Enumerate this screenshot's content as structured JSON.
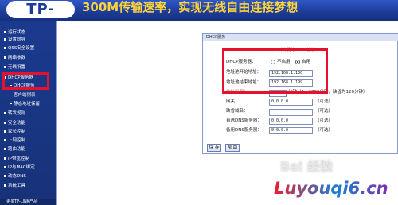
{
  "banner": {
    "logo": "TP-LINK",
    "slogan": "300M传输速率，实现无线自由连接梦想"
  },
  "sidebar": {
    "items": [
      {
        "label": "运行状态",
        "kind": "item"
      },
      {
        "label": "设置向导",
        "kind": "item"
      },
      {
        "label": "QSS安全设置",
        "kind": "item"
      },
      {
        "label": "网络参数",
        "kind": "item"
      },
      {
        "label": "无线设置",
        "kind": "item"
      },
      {
        "label": "DHCP服务器",
        "kind": "item"
      },
      {
        "label": "DHCP服务",
        "kind": "sub"
      },
      {
        "label": "客户端列表",
        "kind": "sub"
      },
      {
        "label": "静态地址保留",
        "kind": "sub"
      },
      {
        "label": "转发规则",
        "kind": "item"
      },
      {
        "label": "安全功能",
        "kind": "item"
      },
      {
        "label": "家长控制",
        "kind": "item"
      },
      {
        "label": "上网控制",
        "kind": "item"
      },
      {
        "label": "路由功能",
        "kind": "item"
      },
      {
        "label": "IP带宽控制",
        "kind": "item"
      },
      {
        "label": "IP与MAC绑定",
        "kind": "item"
      },
      {
        "label": "动态DNS",
        "kind": "item"
      },
      {
        "label": "系统工具",
        "kind": "item"
      }
    ],
    "footer": "更多TP-LINK产品"
  },
  "panel": {
    "title": "DHCP服务",
    "description": "计算机的TCP/IP协议",
    "dhcp_label": "DHCP服务器：",
    "radio_off": "不启用",
    "radio_on": "启用",
    "start_label": "地址池开始地址：",
    "start_value": "192.168.1.100",
    "end_label": "地址池结束地址：",
    "end_value": "192.168.1.199",
    "lease_label": "地址租期：",
    "lease_unit": "分钟（1～2880分钟，缺省为120分钟）",
    "gateway_label": "网关：",
    "gateway_value": "0.0.0.0",
    "domain_label": "缺省域名：",
    "domain_value": "",
    "dns1_label": "首选DNS服务器：",
    "dns1_value": "0.0.0.0",
    "dns2_label": "备用DNS服务器：",
    "dns2_value": "0.0.0.0",
    "optional": "（可选）",
    "save": "保 存",
    "help": "帮 助"
  },
  "watermarks": {
    "baidu": "Bai 经验",
    "site": "Luyouqi6.cn"
  }
}
